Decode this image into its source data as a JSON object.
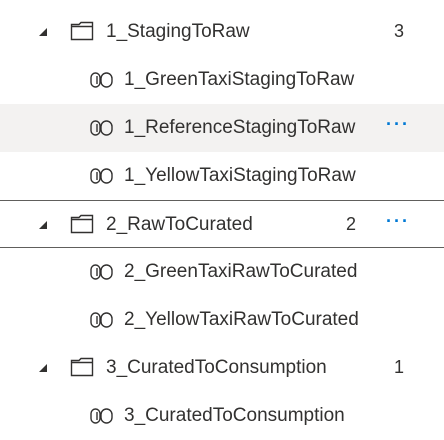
{
  "tree": [
    {
      "type": "folder",
      "name": "1_StagingToRaw",
      "count": "3",
      "selected": false,
      "hover": false,
      "more": false
    },
    {
      "type": "pipeline",
      "name": "1_GreenTaxiStagingToRaw",
      "hover": false,
      "more": false
    },
    {
      "type": "pipeline",
      "name": "1_ReferenceStagingToRaw",
      "hover": true,
      "more": true
    },
    {
      "type": "pipeline",
      "name": "1_YellowTaxiStagingToRaw",
      "hover": false,
      "more": false
    },
    {
      "type": "folder",
      "name": "2_RawToCurated",
      "count": "2",
      "selected": true,
      "hover": false,
      "more": true
    },
    {
      "type": "pipeline",
      "name": "2_GreenTaxiRawToCurated",
      "hover": false,
      "more": false
    },
    {
      "type": "pipeline",
      "name": "2_YellowTaxiRawToCurated",
      "hover": false,
      "more": false
    },
    {
      "type": "folder",
      "name": "3_CuratedToConsumption",
      "count": "1",
      "selected": false,
      "hover": false,
      "more": false
    },
    {
      "type": "pipeline",
      "name": "3_CuratedToConsumption",
      "hover": false,
      "more": false
    }
  ],
  "more_label": "···",
  "colors": {
    "accent": "#0078d4",
    "text": "#323130",
    "hover_bg": "#f3f2f1"
  }
}
